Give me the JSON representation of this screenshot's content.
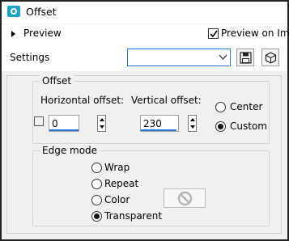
{
  "window": {
    "title": "Offset"
  },
  "preview": {
    "toggle_label": "Preview",
    "preview_on_label": "Preview on Imag",
    "preview_on_checked": true
  },
  "settings": {
    "label": "Settings",
    "combo_value": ""
  },
  "offset": {
    "group_title": "Offset",
    "horizontal_label": "Horizontal offset:",
    "horizontal_value": "0",
    "vertical_label": "Vertical offset:",
    "vertical_value": "230",
    "options": [
      {
        "label": "Center",
        "selected": false
      },
      {
        "label": "Custom",
        "selected": true
      }
    ]
  },
  "edge_mode": {
    "group_title": "Edge mode",
    "options": [
      {
        "label": "Wrap",
        "selected": false
      },
      {
        "label": "Repeat",
        "selected": false
      },
      {
        "label": "Color",
        "selected": false
      },
      {
        "label": "Transparent",
        "selected": true
      }
    ]
  },
  "icons": {
    "app": "offset-app-icon",
    "save": "floppy-disk-icon",
    "presets": "cube-icon",
    "no_color": "no-symbol-icon"
  },
  "colors": {
    "accent": "#2a78d6",
    "app_icon": "#1aa3c8"
  }
}
